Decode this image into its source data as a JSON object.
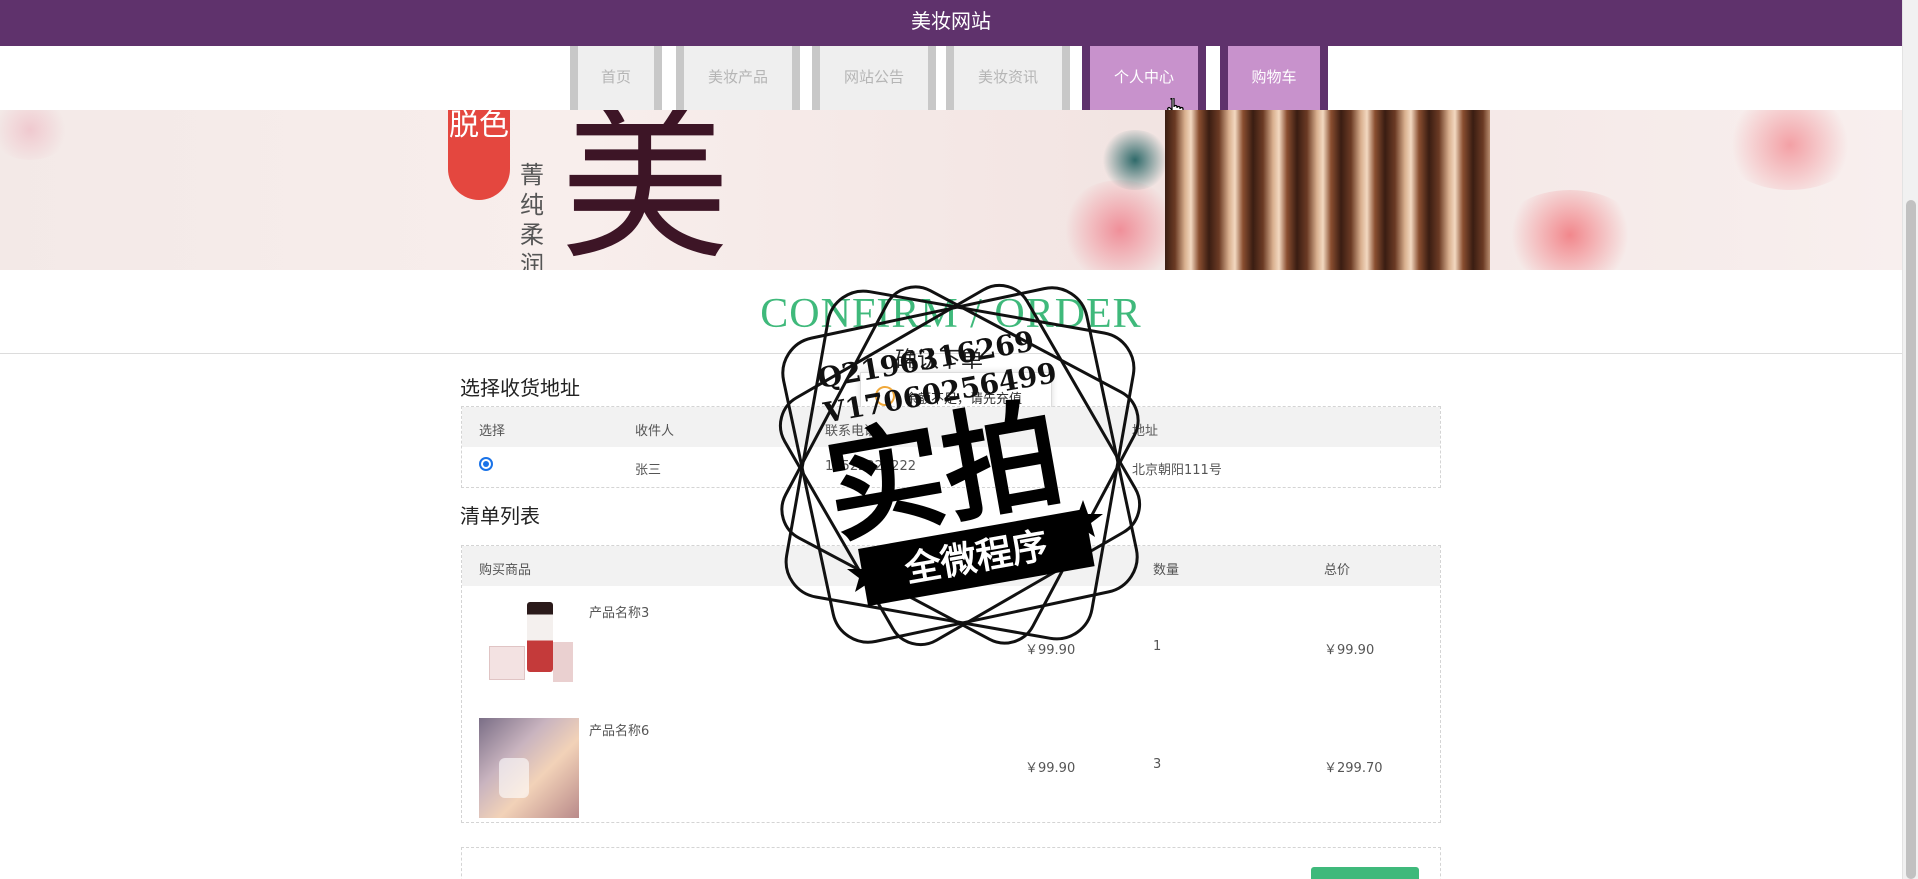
{
  "header": {
    "site_title": "美妆网站"
  },
  "nav": {
    "items": [
      {
        "label": "首页",
        "active": false
      },
      {
        "label": "美妆产品",
        "active": false
      },
      {
        "label": "网站公告",
        "active": false
      },
      {
        "label": "美妆资讯",
        "active": false
      },
      {
        "label": "个人中心",
        "active": true
      },
      {
        "label": "购物车",
        "active": true
      }
    ]
  },
  "banner": {
    "pill_text": "脱色",
    "vertical_text": "菁纯柔润",
    "big_char": "美"
  },
  "page_title": "CONFIRM / ORDER",
  "dialog": {
    "title": "确认下单",
    "message": "余额不足，请先充值"
  },
  "address": {
    "section_title": "选择收货地址",
    "columns": [
      "选择",
      "收件人",
      "联系电话",
      "地址"
    ],
    "rows": [
      {
        "selected": true,
        "name": "张三",
        "phone": "13522222222",
        "address": "北京朝阳111号"
      }
    ]
  },
  "order": {
    "section_title": "清单列表",
    "columns": [
      "购买商品",
      "单价",
      "数量",
      "总价"
    ],
    "items": [
      {
        "name": "产品名称3",
        "price": "￥99.90",
        "qty": "1",
        "total": "￥99.90"
      },
      {
        "name": "产品名称6",
        "price": "￥99.90",
        "qty": "3",
        "total": "￥299.70"
      }
    ]
  },
  "watermark": {
    "line1": "Q2196316269",
    "line2": "V17060256499",
    "big": "实拍",
    "banner": "全微程序"
  },
  "colors": {
    "header": "#5f326c",
    "nav_active": "#c892cc",
    "accent": "#3fb97b"
  }
}
